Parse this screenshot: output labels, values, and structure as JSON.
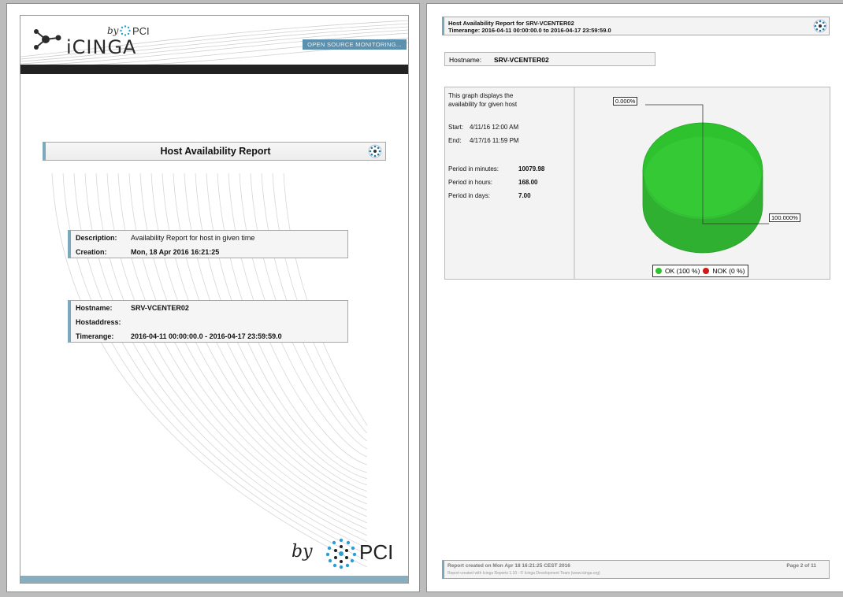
{
  "page1": {
    "brand": {
      "by": "by",
      "pci": "PCI",
      "logo_word": "iCINGA",
      "tagline": "OPEN SOURCE MONITORING..."
    },
    "title": "Host Availability Report",
    "description_box": {
      "description_label": "Description:",
      "description_value": "Availability Report for host in given time",
      "creation_label": "Creation:",
      "creation_value": "Mon, 18 Apr 2016 16:21:25"
    },
    "host_box": {
      "hostname_label": "Hostname:",
      "hostname_value": "SRV-VCENTER02",
      "hostaddress_label": "Hostaddress:",
      "hostaddress_value": "",
      "timerange_label": "Timerange:",
      "timerange_value": "2016-04-11 00:00:00.0 - 2016-04-17 23:59:59.0"
    },
    "footer_brand": {
      "by": "by",
      "pci": "PCI"
    }
  },
  "page2": {
    "header": {
      "line1": "Host Availability Report for SRV-VCENTER02",
      "line2": "Timerange: 2016-04-11 00:00:00.0 to 2016-04-17 23:59:59.0"
    },
    "host": {
      "label": "Hostname:",
      "value": "SRV-VCENTER02"
    },
    "graph_info": {
      "desc_line1": "This graph displays the",
      "desc_line2": "availability for given host",
      "start_label": "Start:",
      "start_value": "4/11/16 12:00 AM",
      "end_label": "End:",
      "end_value": "4/17/16 11:59 PM",
      "minutes_label": "Period in minutes:",
      "minutes_value": "10079.98",
      "hours_label": "Period in hours:",
      "hours_value": "168.00",
      "days_label": "Period in days:",
      "days_value": "7.00"
    },
    "footer": {
      "created": "Report created on Mon Apr 18 16:21:25 CEST 2016",
      "credit": "Report created with Icinga Reports 1.10 - © Icinga Development Team (www.icinga.org)",
      "page": "Page 2 of 11"
    }
  },
  "chart_data": {
    "type": "pie",
    "categories": [
      "OK",
      "NOK"
    ],
    "values": [
      100,
      0
    ],
    "labels": [
      "0.000%",
      "100.000%"
    ],
    "legend": [
      "OK (100 %)",
      "NOK (0 %)"
    ],
    "colors": {
      "ok": "#2fc22f",
      "nok": "#d01818"
    }
  },
  "colors": {
    "accent": "#7aa9bb",
    "dark_bar": "#222222",
    "footer_bar": "#87aec0"
  }
}
